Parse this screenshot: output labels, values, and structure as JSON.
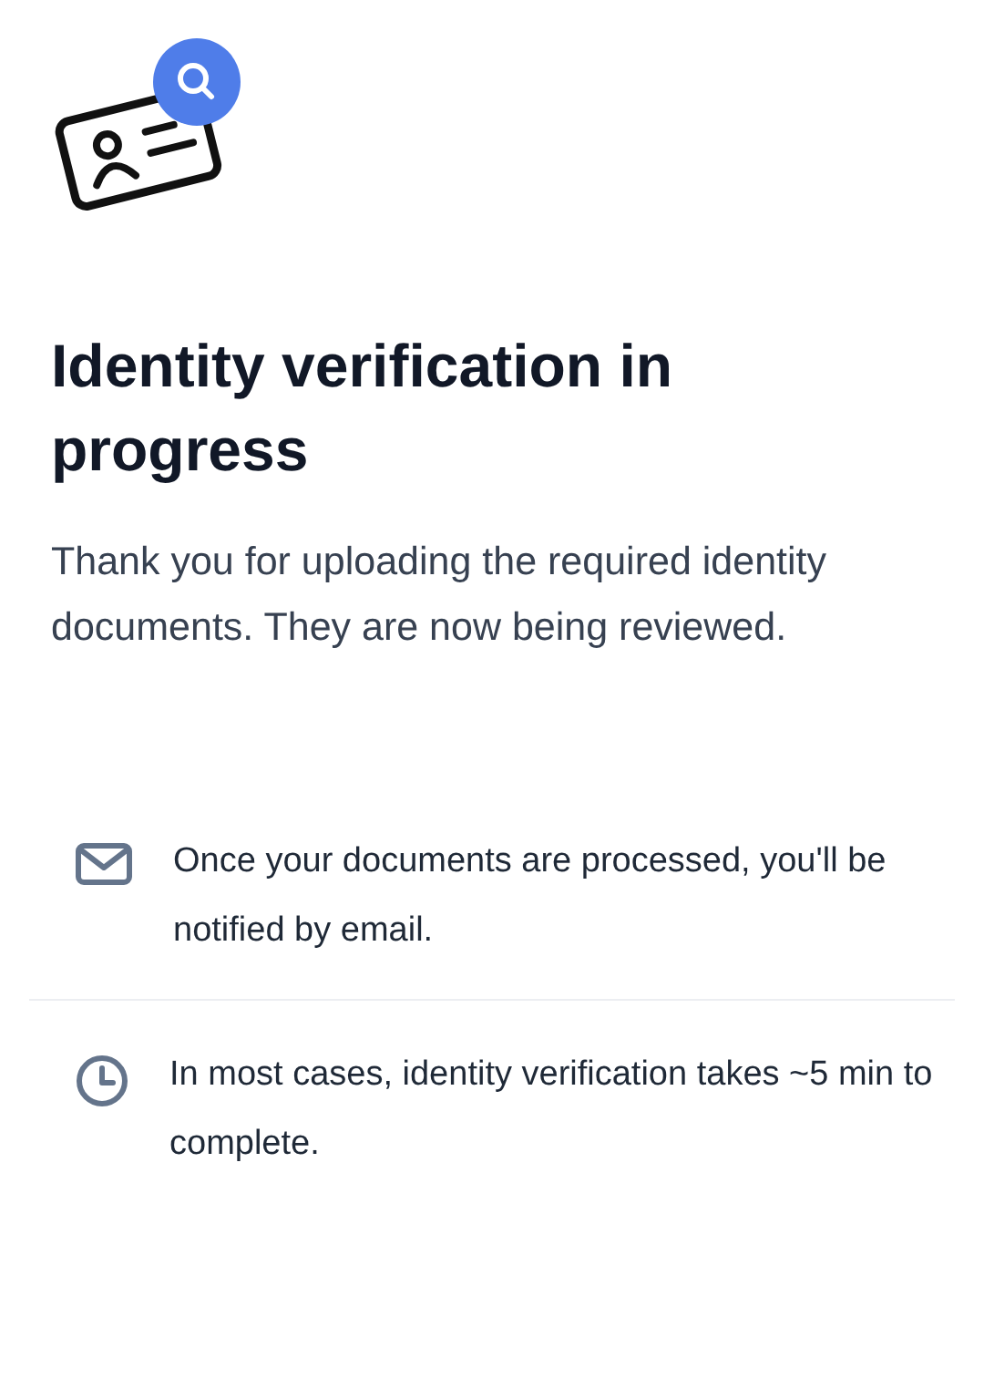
{
  "title": "Identity verification in progress",
  "description": "Thank you for uploading the required identity documents. They are now being reviewed.",
  "info_items": [
    {
      "kind": "email",
      "text": "Once your documents are processed, you'll be notified by email."
    },
    {
      "kind": "clock",
      "text": "In most cases, identity verification takes ~5 min to complete."
    }
  ]
}
